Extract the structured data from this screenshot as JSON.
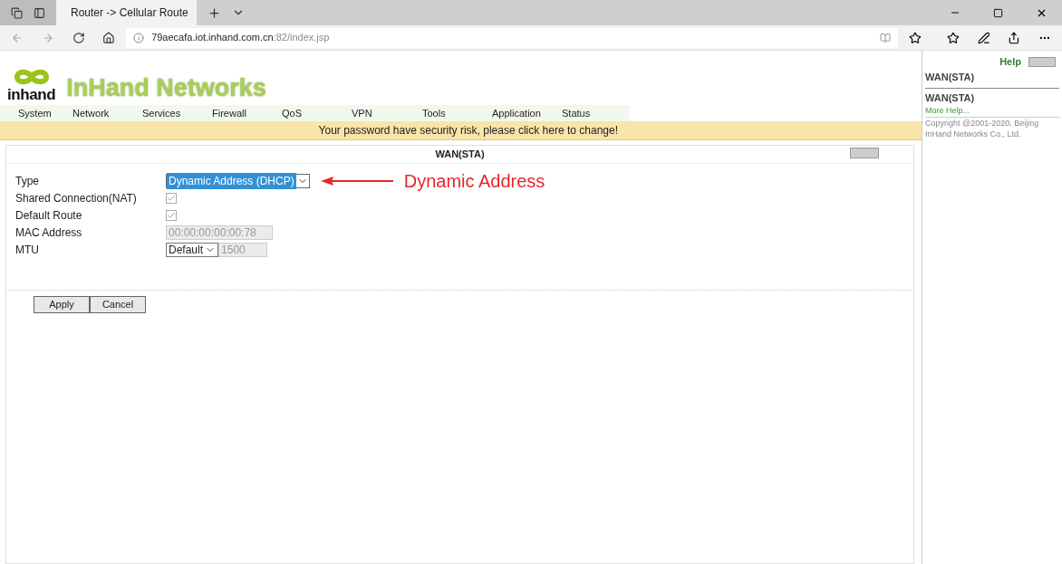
{
  "browser": {
    "tab_title": "Router -> Cellular Route",
    "url_host": "79aecafa.iot.inhand.com.cn",
    "url_rest": ":82/index.jsp"
  },
  "header": {
    "logo_text": "inhand",
    "brand": "InHand Networks"
  },
  "menu": [
    "System",
    "Network",
    "Services",
    "Firewall",
    "QoS",
    "VPN",
    "Tools",
    "Application",
    "Status"
  ],
  "notice": "Your password have security risk, please click here to change!",
  "panel": {
    "title": "WAN(STA)"
  },
  "fields": [
    {
      "kind": "select",
      "label": "Type",
      "value": "Dynamic Address (DHCP)",
      "highlighted": true
    },
    {
      "kind": "checkbox",
      "label": "Shared Connection(NAT)",
      "checked": true
    },
    {
      "kind": "checkbox",
      "label": "Default Route",
      "checked": true
    },
    {
      "kind": "input",
      "label": "MAC Address",
      "value": "00:00:00:00:00:78"
    },
    {
      "kind": "select_input",
      "label": "MTU",
      "value": "Default",
      "input_value": "1500"
    }
  ],
  "annotation": "Dynamic Address",
  "buttons": [
    "Apply",
    "Cancel"
  ],
  "help": {
    "title": "Help",
    "heading": "WAN(STA)",
    "topic": "WAN(STA)",
    "link": "More Help...",
    "copyright": "Copyright @2001-2020, Beijing InHand Networks Co., Ltd."
  }
}
